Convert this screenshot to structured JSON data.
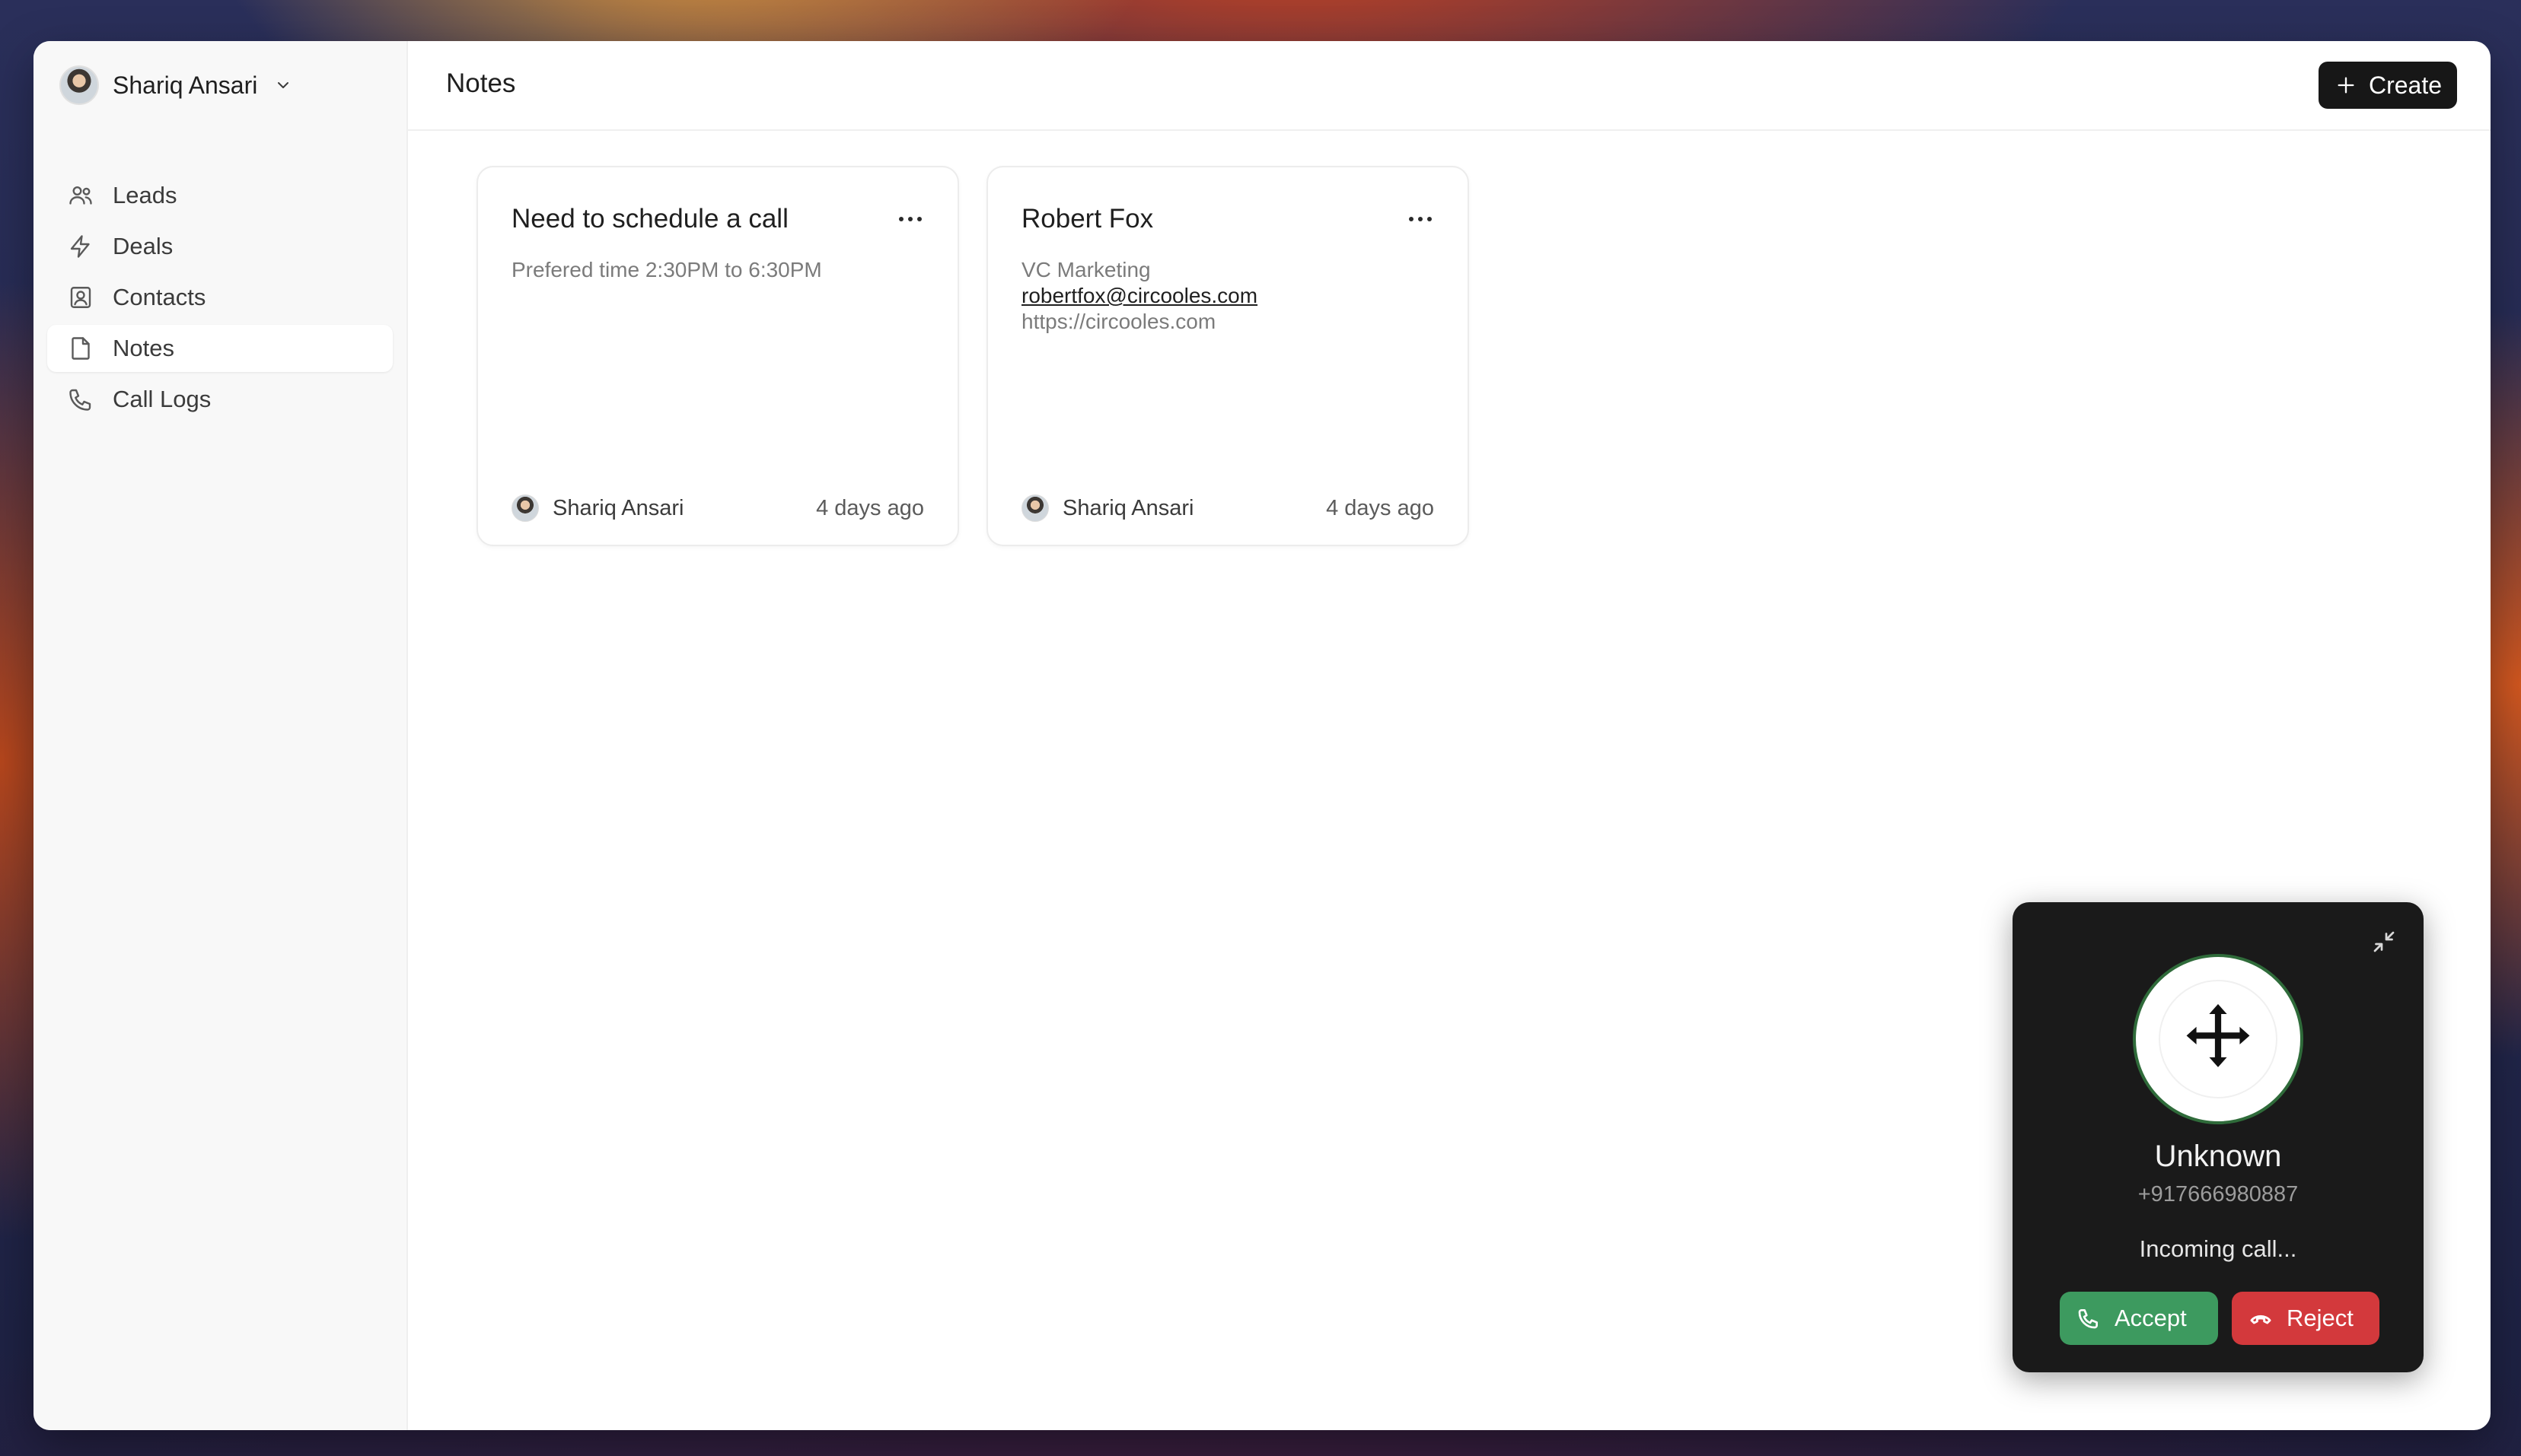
{
  "sidebar": {
    "user_name": "Shariq Ansari",
    "items": [
      {
        "label": "Leads",
        "icon": "users-icon"
      },
      {
        "label": "Deals",
        "icon": "lightning-icon"
      },
      {
        "label": "Contacts",
        "icon": "contact-card-icon"
      },
      {
        "label": "Notes",
        "icon": "file-icon",
        "active": true
      },
      {
        "label": "Call Logs",
        "icon": "phone-icon"
      }
    ]
  },
  "header": {
    "title": "Notes",
    "create_label": "Create"
  },
  "notes": [
    {
      "title": "Need to schedule a call",
      "body": "Prefered time 2:30PM to 6:30PM",
      "author": "Shariq Ansari",
      "time": "4 days ago"
    },
    {
      "title": "Robert Fox",
      "company": "VC Marketing",
      "email": "robertfox@circooles.com",
      "website": "https://circooles.com",
      "author": "Shariq Ansari",
      "time": "4 days ago"
    }
  ],
  "call": {
    "caller_name": "Unknown",
    "number": "+917666980887",
    "status": "Incoming call...",
    "accept_label": "Accept",
    "reject_label": "Reject",
    "accept_color": "#3d9a5f",
    "reject_color": "#d3393c"
  }
}
